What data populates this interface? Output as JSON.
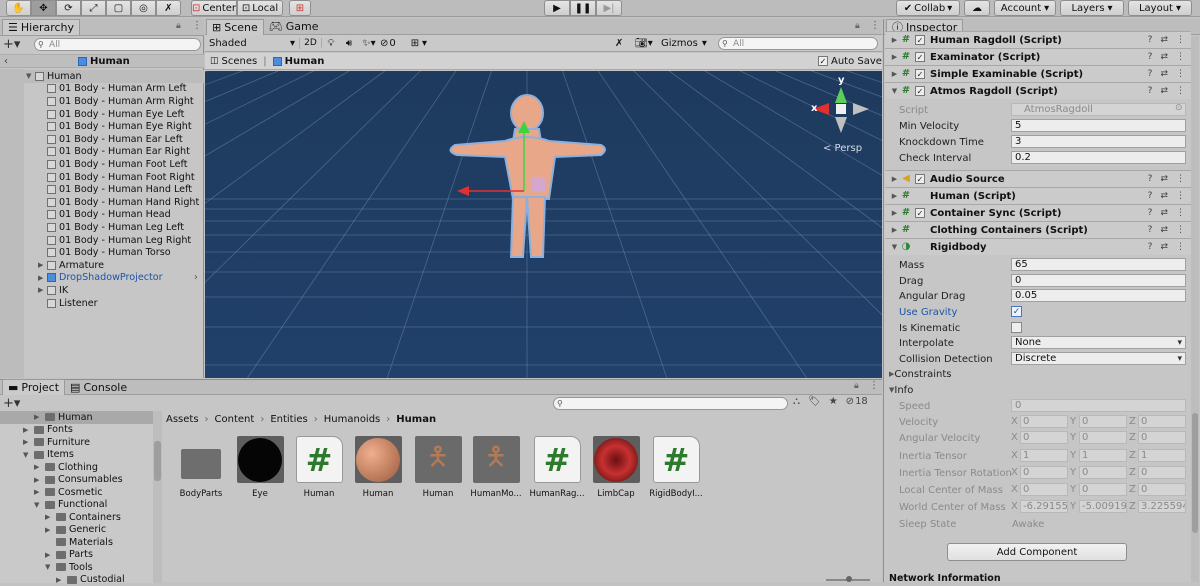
{
  "toolbar": {
    "tools": [
      "hand-tool",
      "move-tool",
      "rotate-tool",
      "scale-tool",
      "rect-tool",
      "transform-tool",
      "custom-tool"
    ],
    "pivot": "Center",
    "space": "Local",
    "collab": "Collab",
    "account": "Account",
    "layers": "Layers",
    "layout": "Layout"
  },
  "hierarchy": {
    "tab": "Hierarchy",
    "search_placeholder": "All",
    "scene_name": "Human",
    "root": "Human",
    "children": [
      "01 Body - Human Arm Left",
      "01 Body - Human Arm Right",
      "01 Body - Human Eye Left",
      "01 Body - Human Eye Right",
      "01 Body - Human Ear Left",
      "01 Body - Human Ear Right",
      "01 Body - Human Foot Left",
      "01 Body - Human Foot Right",
      "01 Body - Human Hand Left",
      "01 Body - Human Hand Right",
      "01 Body - Human Head",
      "01 Body - Human Leg Left",
      "01 Body - Human Leg Right",
      "01 Body - Human Torso"
    ],
    "others": [
      {
        "label": "Armature",
        "expandable": true,
        "prefab": false
      },
      {
        "label": "DropShadowProjector",
        "expandable": true,
        "prefab": true
      },
      {
        "label": "IK",
        "expandable": true,
        "prefab": false
      },
      {
        "label": "Listener",
        "expandable": false,
        "prefab": false
      }
    ]
  },
  "scene": {
    "tab_scene": "Scene",
    "tab_game": "Game",
    "shading": "Shaded",
    "mode_2d": "2D",
    "hidden_count": "0",
    "gizmos": "Gizmos",
    "search_placeholder": "All",
    "breadcrumb_root": "Scenes",
    "breadcrumb_current": "Human",
    "auto_save": "Auto Save",
    "persp": "< Persp",
    "axis_x": "x",
    "axis_y": "y"
  },
  "project": {
    "tab_project": "Project",
    "tab_console": "Console",
    "hidden_count": "18",
    "breadcrumb": [
      "Assets",
      "Content",
      "Entities",
      "Humanoids",
      "Human"
    ],
    "tree": [
      {
        "label": "Human",
        "indent": 2,
        "expanded": false,
        "selected": true
      },
      {
        "label": "Fonts",
        "indent": 1,
        "expanded": false
      },
      {
        "label": "Furniture",
        "indent": 1,
        "expanded": false
      },
      {
        "label": "Items",
        "indent": 1,
        "expanded": true
      },
      {
        "label": "Clothing",
        "indent": 2,
        "expanded": false
      },
      {
        "label": "Consumables",
        "indent": 2,
        "expanded": false
      },
      {
        "label": "Cosmetic",
        "indent": 2,
        "expanded": false
      },
      {
        "label": "Functional",
        "indent": 2,
        "expanded": true
      },
      {
        "label": "Containers",
        "indent": 3,
        "expanded": false
      },
      {
        "label": "Generic",
        "indent": 3,
        "expanded": false
      },
      {
        "label": "Materials",
        "indent": 3,
        "expanded": null
      },
      {
        "label": "Parts",
        "indent": 3,
        "expanded": false
      },
      {
        "label": "Tools",
        "indent": 3,
        "expanded": true
      },
      {
        "label": "Custodial",
        "indent": 4,
        "expanded": false
      }
    ],
    "assets": [
      {
        "label": "BodyParts",
        "kind": "folder"
      },
      {
        "label": "Eye",
        "kind": "black-sphere"
      },
      {
        "label": "Human",
        "kind": "script"
      },
      {
        "label": "Human",
        "kind": "skin-sphere"
      },
      {
        "label": "Human",
        "kind": "figure"
      },
      {
        "label": "HumanMo...",
        "kind": "figure"
      },
      {
        "label": "HumanRag...",
        "kind": "script"
      },
      {
        "label": "LimbCap",
        "kind": "red-sphere"
      },
      {
        "label": "RigidBodyI...",
        "kind": "script"
      }
    ]
  },
  "inspector": {
    "tab": "Inspector",
    "components_top": [
      {
        "label": "Human Ragdoll (Script)",
        "checked": true
      },
      {
        "label": "Examinator (Script)",
        "checked": true
      },
      {
        "label": "Simple Examinable (Script)",
        "checked": true
      },
      {
        "label": "Atmos Ragdoll (Script)",
        "checked": true
      }
    ],
    "atmos": {
      "script_label": "Script",
      "script_value": "AtmosRagdoll",
      "min_velocity_label": "Min Velocity",
      "min_velocity": "5",
      "knockdown_label": "Knockdown Time",
      "knockdown": "3",
      "check_label": "Check Interval",
      "check": "0.2"
    },
    "components_mid": [
      {
        "label": "Audio Source",
        "checked": true,
        "icon": "speaker-icon"
      },
      {
        "label": "Human (Script)",
        "checked": null,
        "icon": "script-icon"
      },
      {
        "label": "Container Sync (Script)",
        "checked": true,
        "icon": "script-icon"
      },
      {
        "label": "Clothing Containers (Script)",
        "checked": null,
        "icon": "script-icon"
      }
    ],
    "rigidbody": {
      "title": "Rigidbody",
      "mass_label": "Mass",
      "mass": "65",
      "drag_label": "Drag",
      "drag": "0",
      "angular_drag_label": "Angular Drag",
      "angular_drag": "0.05",
      "use_gravity_label": "Use Gravity",
      "use_gravity": true,
      "is_kinematic_label": "Is Kinematic",
      "is_kinematic": false,
      "interpolate_label": "Interpolate",
      "interpolate": "None",
      "collision_label": "Collision Detection",
      "collision": "Discrete",
      "constraints_label": "Constraints",
      "info_label": "Info",
      "speed_label": "Speed",
      "speed": "0",
      "velocity_label": "Velocity",
      "velocity": [
        "0",
        "0",
        "0"
      ],
      "ang_velocity_label": "Angular Velocity",
      "ang_velocity": [
        "0",
        "0",
        "0"
      ],
      "inertia_label": "Inertia Tensor",
      "inertia": [
        "1",
        "1",
        "1"
      ],
      "inertia_rot_label": "Inertia Tensor Rotation",
      "inertia_rot": [
        "0",
        "0",
        "0"
      ],
      "local_com_label": "Local Center of Mass",
      "local_com": [
        "0",
        "0",
        "0"
      ],
      "world_com_label": "World Center of Mass",
      "world_com": [
        "-6.29155",
        "-5.00919",
        "3.225594"
      ],
      "sleep_label": "Sleep State",
      "sleep": "Awake"
    },
    "axis": [
      "X",
      "Y",
      "Z"
    ],
    "add_component": "Add Component",
    "network_info": "Network Information"
  },
  "colors": {
    "scene_bg": "#1f3a5c",
    "selection": "#3e7ce0",
    "panel": "#c2c2c2",
    "script_green": "#2c7a2c"
  }
}
